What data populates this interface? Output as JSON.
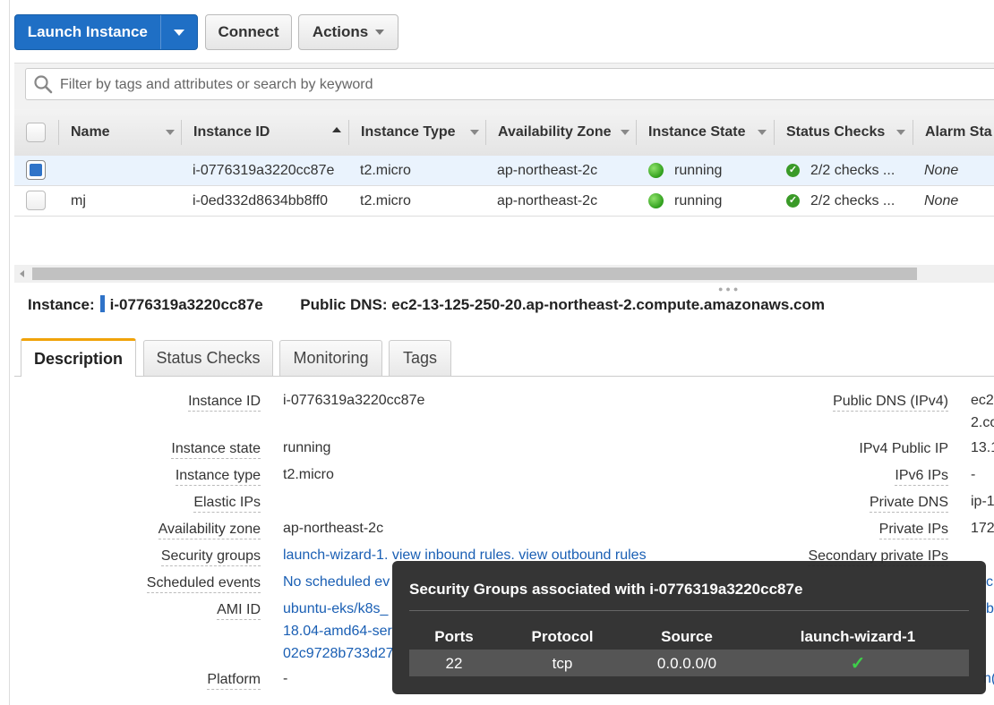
{
  "toolbar": {
    "launch_label": "Launch Instance",
    "connect_label": "Connect",
    "actions_label": "Actions"
  },
  "search": {
    "placeholder": "Filter by tags and attributes or search by keyword",
    "value": ""
  },
  "table": {
    "columns": [
      "Name",
      "Instance ID",
      "Instance Type",
      "Availability Zone",
      "Instance State",
      "Status Checks",
      "Alarm Sta"
    ],
    "rows": [
      {
        "selected": true,
        "name": "",
        "instance_id": "i-0776319a3220cc87e",
        "type": "t2.micro",
        "zone": "ap-northeast-2c",
        "state": "running",
        "status": "2/2 checks ...",
        "alarm": "None"
      },
      {
        "selected": false,
        "name": "mj",
        "instance_id": "i-0ed332d8634bb8ff0",
        "type": "t2.micro",
        "zone": "ap-northeast-2c",
        "state": "running",
        "status": "2/2 checks ...",
        "alarm": "None"
      }
    ]
  },
  "details": {
    "instance_label": "Instance:",
    "instance_id": "i-0776319a3220cc87e",
    "dns_label": "Public DNS:",
    "dns_value": "ec2-13-125-250-20.ap-northeast-2.compute.amazonaws.com",
    "tabs": [
      "Description",
      "Status Checks",
      "Monitoring",
      "Tags"
    ],
    "active_tab": "Description"
  },
  "description": {
    "left": [
      {
        "label": "Instance ID",
        "value": "i-0776319a3220cc87e"
      },
      {
        "label": "Instance state",
        "value": "running"
      },
      {
        "label": "Instance type",
        "value": "t2.micro"
      },
      {
        "label": "Elastic IPs",
        "value": ""
      },
      {
        "label": "Availability zone",
        "value": "ap-northeast-2c"
      },
      {
        "label": "Security groups",
        "value_parts": [
          "launch-wizard-1",
          ". ",
          "view inbound rules",
          ". ",
          "view outbound rules"
        ]
      },
      {
        "label": "Scheduled events",
        "value": "No scheduled ev"
      },
      {
        "label": "AMI ID",
        "value_lines": [
          "ubuntu-eks/k8s_",
          "18.04-amd64-ser",
          "02c9728b733d27"
        ]
      },
      {
        "label": "Platform",
        "value": "-"
      }
    ],
    "right": [
      {
        "label": "Public DNS (IPv4)",
        "value_lines": [
          "ec2",
          "2.co"
        ]
      },
      {
        "label": "IPv4 Public IP",
        "value": "13.1"
      },
      {
        "label": "IPv6 IPs",
        "value": "-"
      },
      {
        "label": "Private DNS",
        "value": "ip-1"
      },
      {
        "label": "Private IPs",
        "value": "172"
      },
      {
        "label": "Secondary private IPs",
        "value": ""
      }
    ],
    "right_edge_fragments": [
      "c",
      "b",
      "n("
    ]
  },
  "popup": {
    "title": "Security Groups associated with i-0776319a3220cc87e",
    "headers": [
      "Ports",
      "Protocol",
      "Source",
      "launch-wizard-1"
    ],
    "row": {
      "port": "22",
      "protocol": "tcp",
      "source": "0.0.0.0/0",
      "check": "✓"
    }
  },
  "colors": {
    "primary": "#1f6fc5",
    "tab_accent": "#f0a30a",
    "running": "#2f9e1c",
    "link": "#1a5fb4"
  }
}
